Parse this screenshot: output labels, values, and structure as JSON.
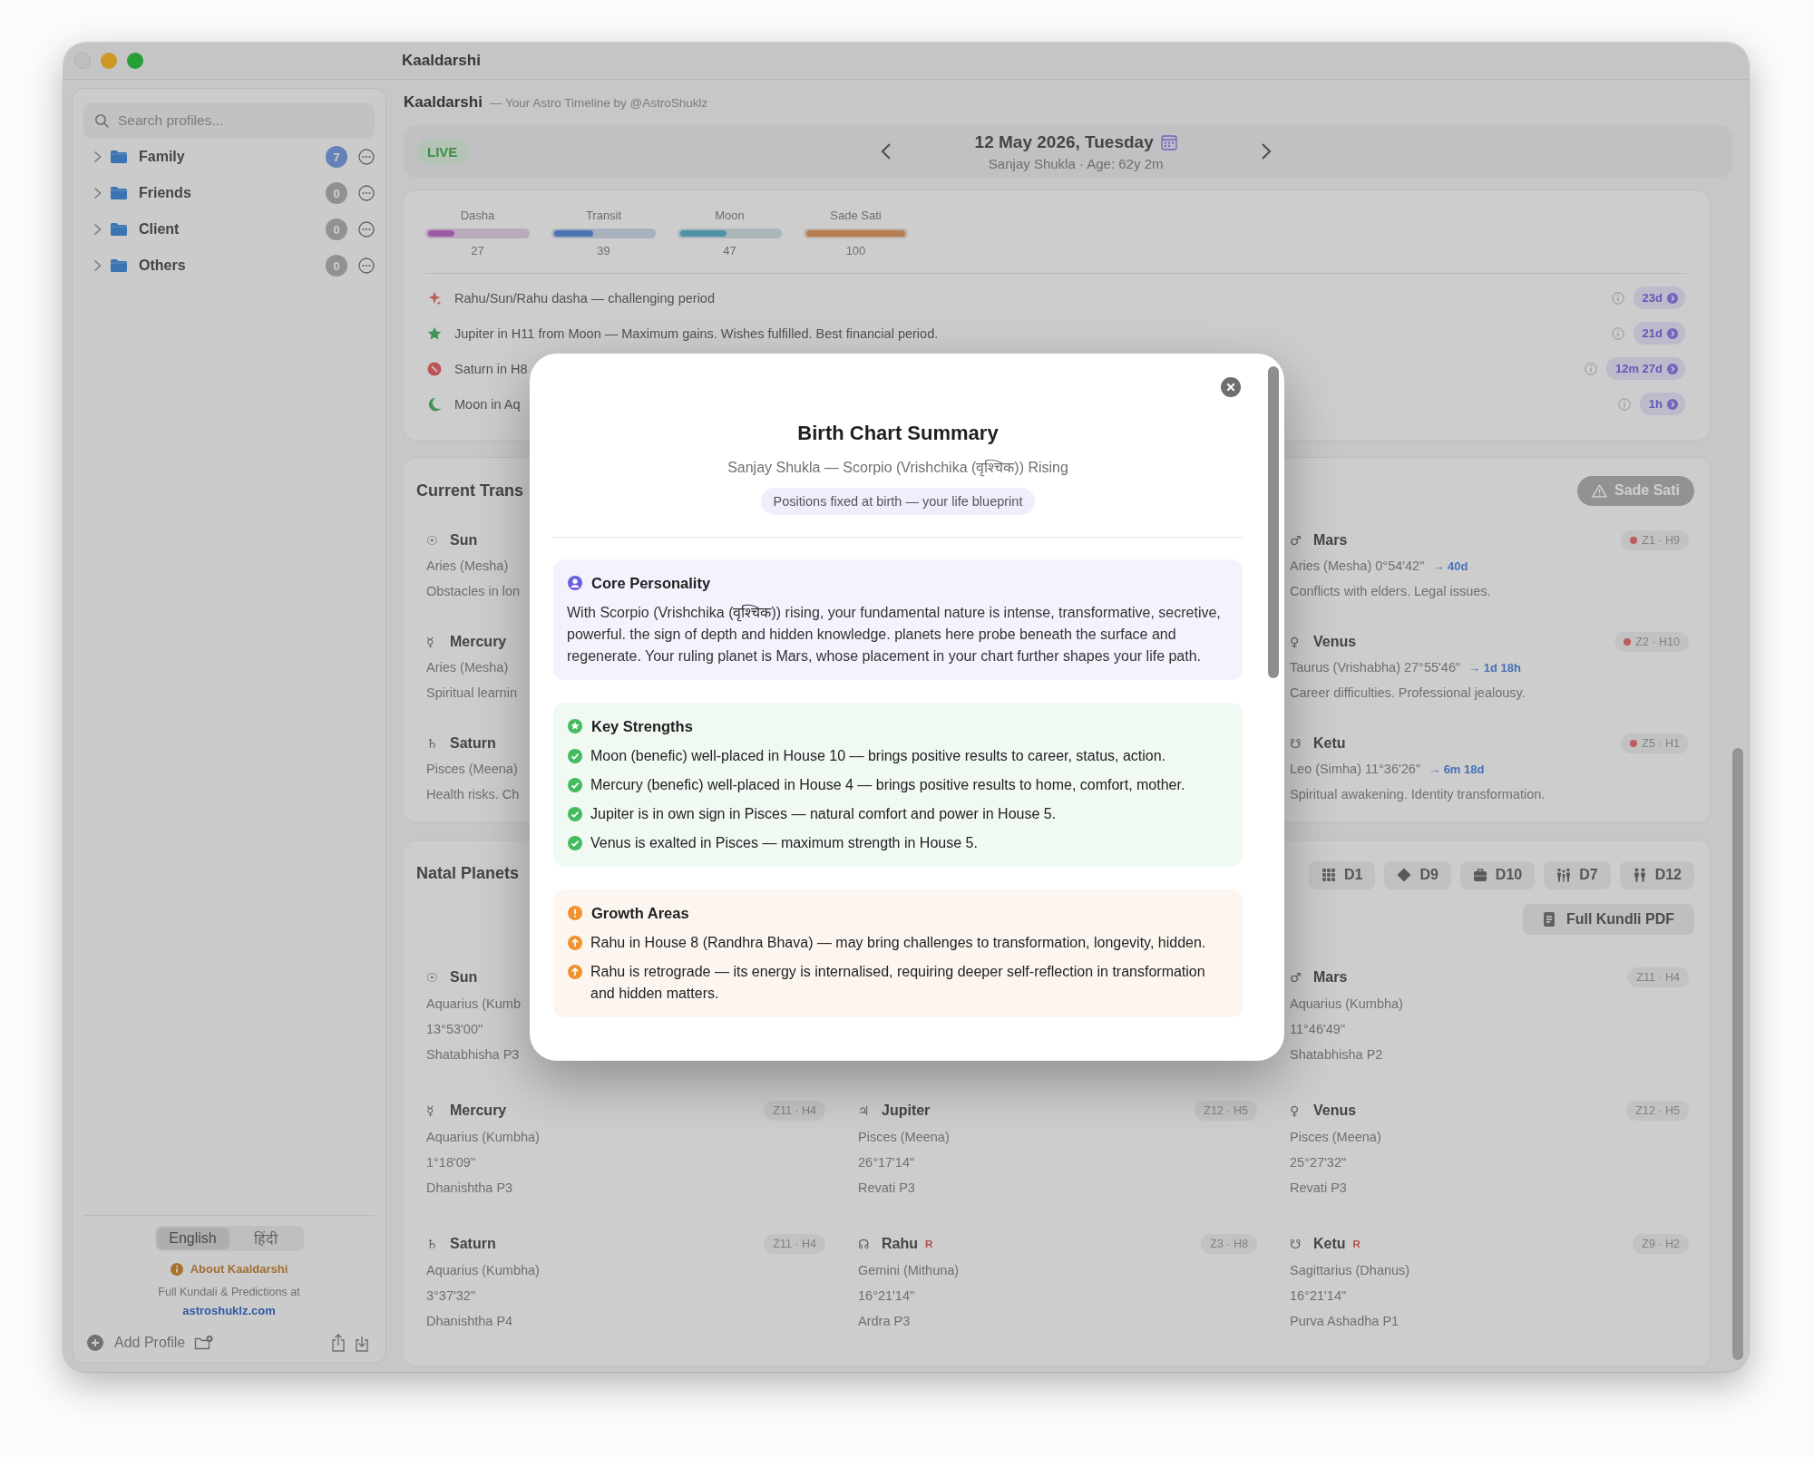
{
  "window": {
    "title": "Kaaldarshi"
  },
  "sidebar": {
    "search": {
      "placeholder": "Search profiles..."
    },
    "folders": [
      {
        "name": "Family",
        "count": "7",
        "active": true,
        "expanded": false
      },
      {
        "name": "Friends",
        "count": "0",
        "active": false,
        "expanded": false
      },
      {
        "name": "Client",
        "count": "0",
        "active": false,
        "expanded": false
      },
      {
        "name": "Others",
        "count": "0",
        "active": false,
        "expanded": false
      }
    ],
    "languages": [
      {
        "label": "English",
        "selected": true
      },
      {
        "label": "हिंदी",
        "selected": false
      }
    ],
    "about": "About Kaaldarshi",
    "promo": "Full Kundali & Predictions at",
    "link": "astroshuklz.com",
    "add_profile": "Add Profile"
  },
  "header": {
    "app_name": "Kaaldarshi",
    "tagline": "— Your Astro Timeline by @AstroShuklz"
  },
  "date_bar": {
    "live": "LIVE",
    "date": "12 May 2026, Tuesday",
    "subtitle": "Sanjay Shukla · Age: 62y 2m"
  },
  "meters": [
    {
      "label": "Dasha",
      "level": 0.27,
      "reading": "27",
      "color": "#9f59a9"
    },
    {
      "label": "Transit",
      "level": 0.39,
      "reading": "39",
      "color": "#4b73b5"
    },
    {
      "label": "Moon",
      "level": 0.47,
      "reading": "47",
      "color": "#4f92a8"
    },
    {
      "label": "Sade Sati",
      "level": 1,
      "reading": "100",
      "color": "#b87d4f"
    }
  ],
  "insights": [
    {
      "kind": "sparkle",
      "text": "Rahu/Sun/Rahu dasha — challenging period",
      "duration": "23d"
    },
    {
      "kind": "star",
      "text": "Jupiter in H11 from Moon — Maximum gains. Wishes fulfilled. Best financial period.",
      "duration": "21d"
    },
    {
      "kind": "alert",
      "text": "Saturn in H8",
      "duration": "12m 27d"
    },
    {
      "kind": "moon",
      "text": "Moon in Aq",
      "duration": "1h"
    }
  ],
  "current_transits": {
    "title": "Current Trans",
    "badge": "Sade Sati",
    "rows": [
      {
        "left": {
          "symbol": "☉",
          "name": "Sun",
          "position": "Aries (Mesha)",
          "effect": "Obstacles in lon"
        },
        "right": {
          "symbol": "♂",
          "name": "Mars",
          "position": "Aries (Mesha) 0°54'42\"",
          "move": "→ 40d",
          "effect": "Conflicts with elders. Legal issues.",
          "house": "Z1 · H9",
          "alert": true
        }
      },
      {
        "left": {
          "symbol": "☿",
          "name": "Mercury",
          "position": "Aries (Mesha)",
          "effect": "Spiritual learnin"
        },
        "right": {
          "symbol": "♀",
          "name": "Venus",
          "position": "Taurus (Vrishabha) 27°55'46\"",
          "move": "→ 1d 18h",
          "effect": "Career difficulties. Professional jealousy.",
          "house": "Z2 · H10",
          "alert": true
        }
      },
      {
        "left": {
          "symbol": "♄",
          "name": "Saturn",
          "position": "Pisces (Meena)",
          "effect": "Health risks. Ch"
        },
        "right": {
          "symbol": "☋",
          "name": "Ketu",
          "position": "Leo (Simha) 11°36'26\"",
          "move": "→ 6m 18d",
          "effect": "Spiritual awakening. Identity transformation.",
          "house": "Z5 · H1",
          "alert": true
        }
      }
    ]
  },
  "natal_planets": {
    "title": "Natal Planets",
    "chart_tabs": [
      {
        "label": "D1",
        "kind": "grid"
      },
      {
        "label": "D9",
        "kind": "diamond"
      },
      {
        "label": "D10",
        "kind": "briefcase"
      },
      {
        "label": "D7",
        "kind": "family"
      },
      {
        "label": "D12",
        "kind": "couple"
      }
    ],
    "pdf_button": "Full Kundli PDF",
    "rows": [
      {
        "left": {
          "symbol": "☉",
          "name": "Sun",
          "sign": "Aquarius (Kumb",
          "degree": "13°53'00\"",
          "nakshatra": "Shatabhisha P3"
        },
        "right": {
          "symbol": "♂",
          "name": "Mars",
          "sign": "Aquarius (Kumbha)",
          "degree": "11°46'49\"",
          "nakshatra": "Shatabhisha P2",
          "house": "Z11 · H4"
        }
      },
      {
        "left": {
          "symbol": "☿",
          "name": "Mercury",
          "sign": "Aquarius (Kumbha)",
          "degree": "1°18'09\"",
          "nakshatra": "Dhanishtha P3",
          "house": "Z11 · H4"
        },
        "middle": {
          "symbol": "♃",
          "name": "Jupiter",
          "sign": "Pisces (Meena)",
          "degree": "26°17'14\"",
          "nakshatra": "Revati P3",
          "house": "Z12 · H5"
        },
        "right": {
          "symbol": "♀",
          "name": "Venus",
          "sign": "Pisces (Meena)",
          "degree": "25°27'32\"",
          "nakshatra": "Revati P3",
          "house": "Z12 · H5"
        }
      },
      {
        "left": {
          "symbol": "♄",
          "name": "Saturn",
          "sign": "Aquarius (Kumbha)",
          "degree": "3°37'32\"",
          "nakshatra": "Dhanishtha P4",
          "house": "Z11 · H4"
        },
        "middle": {
          "symbol": "☊",
          "name": "Rahu",
          "retro": "R",
          "sign": "Gemini (Mithuna)",
          "degree": "16°21'14\"",
          "nakshatra": "Ardra P3",
          "house": "Z3 · H8"
        },
        "right": {
          "symbol": "☋",
          "name": "Ketu",
          "retro": "R",
          "sign": "Sagittarius (Dhanus)",
          "degree": "16°21'14\"",
          "nakshatra": "Purva Ashadha P1",
          "house": "Z9 · H2"
        }
      }
    ]
  },
  "modal": {
    "title": "Birth Chart Summary",
    "subtitle": "Sanjay Shukla — Scorpio (Vrishchika (वृश्चिक)) Rising",
    "note": "Positions fixed at birth — your life blueprint",
    "sections": [
      {
        "kind": "personality",
        "title": "Core Personality",
        "text": "With Scorpio (Vrishchika (वृश्चिक)) rising, your fundamental nature is intense, transformative, secretive, powerful. the sign of depth and hidden knowledge. planets here probe beneath the surface and regenerate. Your ruling planet is Mars, whose placement in your chart further shapes your life path."
      },
      {
        "kind": "strengths",
        "title": "Key Strengths",
        "items": [
          "Moon (benefic) well-placed in House 10 — brings positive results to career, status, action.",
          "Mercury (benefic) well-placed in House 4 — brings positive results to home, comfort, mother.",
          "Jupiter is in own sign in Pisces — natural comfort and power in House 5.",
          "Venus is exalted in Pisces — maximum strength in House 5."
        ]
      },
      {
        "kind": "growth",
        "title": "Growth Areas",
        "items": [
          "Rahu in House 8 (Randhra Bhava) — may bring challenges to transformation, longevity, hidden.",
          "Rahu is retrograde — its energy is internalised, requiring deeper self-reflection in transformation and hidden matters."
        ]
      }
    ]
  }
}
